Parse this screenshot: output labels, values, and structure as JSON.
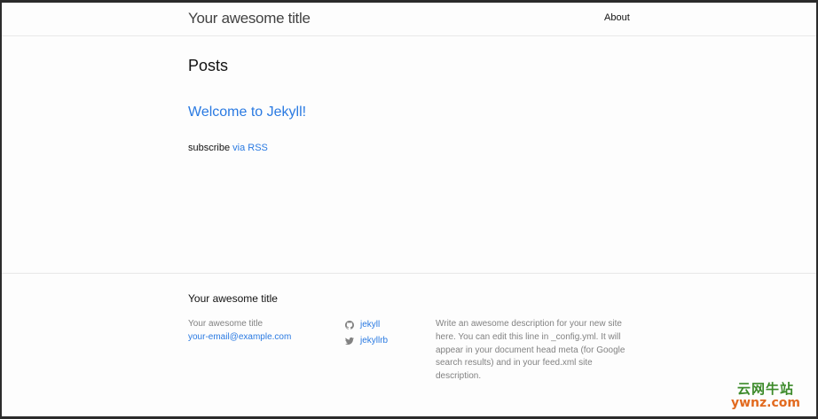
{
  "header": {
    "site_title": "Your awesome title",
    "nav": [
      {
        "label": "About"
      }
    ]
  },
  "main": {
    "heading": "Posts",
    "posts": [
      {
        "title": "Welcome to Jekyll!"
      }
    ],
    "rss": {
      "prefix": "subscribe ",
      "link_label": "via RSS"
    }
  },
  "footer": {
    "heading": "Your awesome title",
    "name": "Your awesome title",
    "email": "your-email@example.com",
    "social": [
      {
        "icon": "github-icon",
        "label": "jekyll"
      },
      {
        "icon": "twitter-icon",
        "label": "jekyllrb"
      }
    ],
    "description": "Write an awesome description for your new site here. You can edit this line in _config.yml. It will appear in your document head meta (for Google search results) and in your feed.xml site description."
  },
  "watermark": {
    "line1": "云网牛站",
    "line2": "ywnz.com"
  },
  "colors": {
    "link": "#2a7ae2",
    "text": "#111111",
    "muted": "#828282",
    "background": "#fdfdfd"
  }
}
